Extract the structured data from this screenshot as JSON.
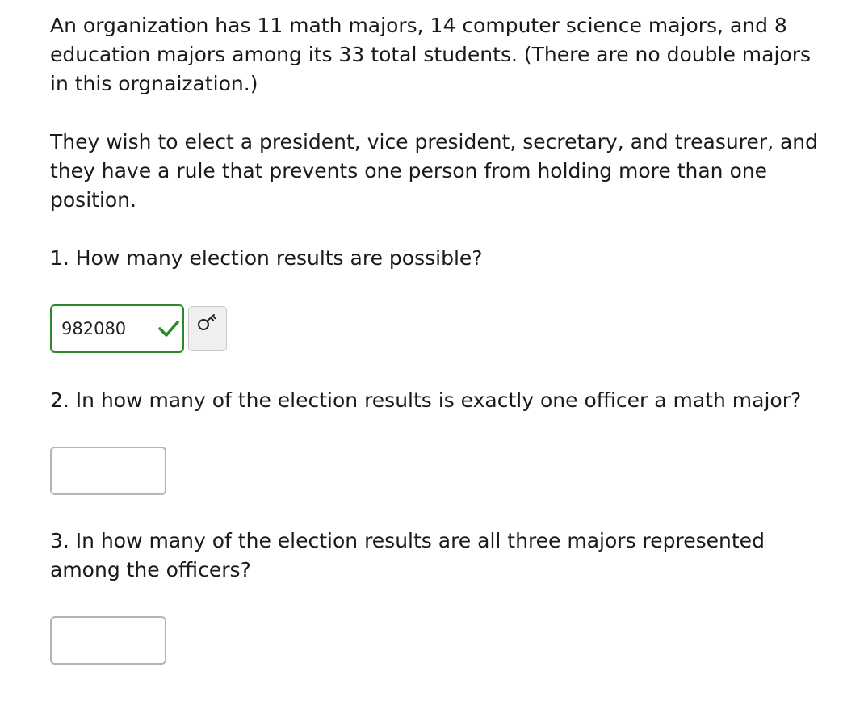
{
  "problem": {
    "intro": "An organization has 11 math majors, 14 computer science majors, and 8 education majors among its 33 total students. (There are no double majors in this orgnaization.)",
    "rule": "They wish to elect a president, vice president, secretary, and treasurer, and they have a rule that prevents one person from holding more than one position."
  },
  "questions": [
    {
      "text": "1. How many election results are possible?",
      "answer_value": "982080",
      "status": "correct",
      "status_icon": "check-icon",
      "status_color": "#2a8a2a",
      "extra_button_icon": "key-icon"
    },
    {
      "text": "2. In how many of the election results is exactly one officer a math major?",
      "answer_value": ""
    },
    {
      "text": "3. In how many of the election results are all three majors represented among the officers?",
      "answer_value": ""
    }
  ]
}
